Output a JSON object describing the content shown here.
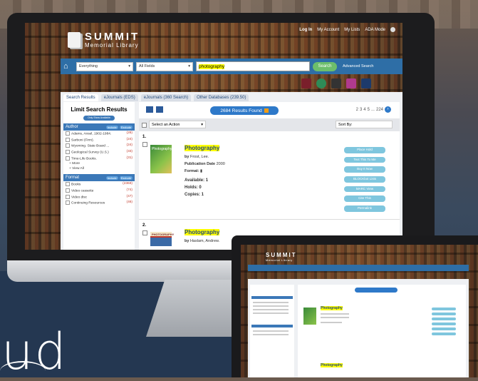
{
  "brand": {
    "title": "SUMMIT",
    "subtitle": "Memorial Library"
  },
  "top_links": {
    "login": "Log In",
    "account": "My Account",
    "lists": "My Lists",
    "ada": "ADA Mode"
  },
  "search": {
    "scope": "Everything",
    "field": "All Fields",
    "query": "photography",
    "button": "Search",
    "advanced": "Advanced Search"
  },
  "tabs": [
    "Search Results",
    "eJournals (EDS)",
    "eJournals (360 Search)",
    "Other Databases (239.50)"
  ],
  "sidebar": {
    "title": "Limit Search Results",
    "only_show": "Only Show Available",
    "include": "Include",
    "exclude": "Exclude",
    "author_head": "Author",
    "authors": [
      {
        "name": "Adams, Ansel, 1902-1984.",
        "count": "(28)"
      },
      {
        "name": "Sarboni (Firm).",
        "count": "(24)"
      },
      {
        "name": "Wyoming. State Board ...",
        "count": "(24)"
      },
      {
        "name": "Geological Survey (U.S.)",
        "count": "(33)"
      },
      {
        "name": "Time-Life Books.",
        "count": "(31)"
      }
    ],
    "more": "+ More",
    "view_all": "+ View All",
    "format_head": "Format",
    "formats": [
      {
        "name": "Books",
        "count": "(2369)"
      },
      {
        "name": "Video cassette",
        "count": "(74)"
      },
      {
        "name": "Video disc",
        "count": "(47)"
      },
      {
        "name": "Continuing Resources",
        "count": "(46)"
      }
    ]
  },
  "results": {
    "found": "2684 Results Found",
    "pager": [
      "2",
      "3",
      "4",
      "5",
      "...",
      "224"
    ],
    "select_action": "Select an Action",
    "sort_by": "Sort By:",
    "records": [
      {
        "num": "1.",
        "title": "Photography",
        "by_label": "by",
        "author": "Frost, Lee.",
        "pub_label": "Publication Date",
        "pub_date": "2000",
        "format_label": "Format:",
        "available": "Available: 1",
        "holds": "Holds: 0",
        "copies": "Copies: 1",
        "cover_text": "Photography"
      },
      {
        "num": "2.",
        "title": "Photography",
        "by_label": "by",
        "author": "Haslam, Andrew.",
        "cover_text": "PHOTOGRAPHY"
      }
    ],
    "actions": [
      "Place Hold",
      "Text This To Me",
      "Buy It Now",
      "BLOCKbot Lists",
      "MARC View",
      "Cite This",
      "Permalink"
    ]
  },
  "laptop": {
    "brand_title": "SUMMIT",
    "brand_sub": "Memorial Library",
    "record_title": "Photography"
  },
  "footer_logo": "ud",
  "colors": {
    "nav_blue": "#2e6ea6",
    "accent_blue": "#2e79c9",
    "action_btn": "#7fc6de",
    "highlight": "#ffff00"
  }
}
